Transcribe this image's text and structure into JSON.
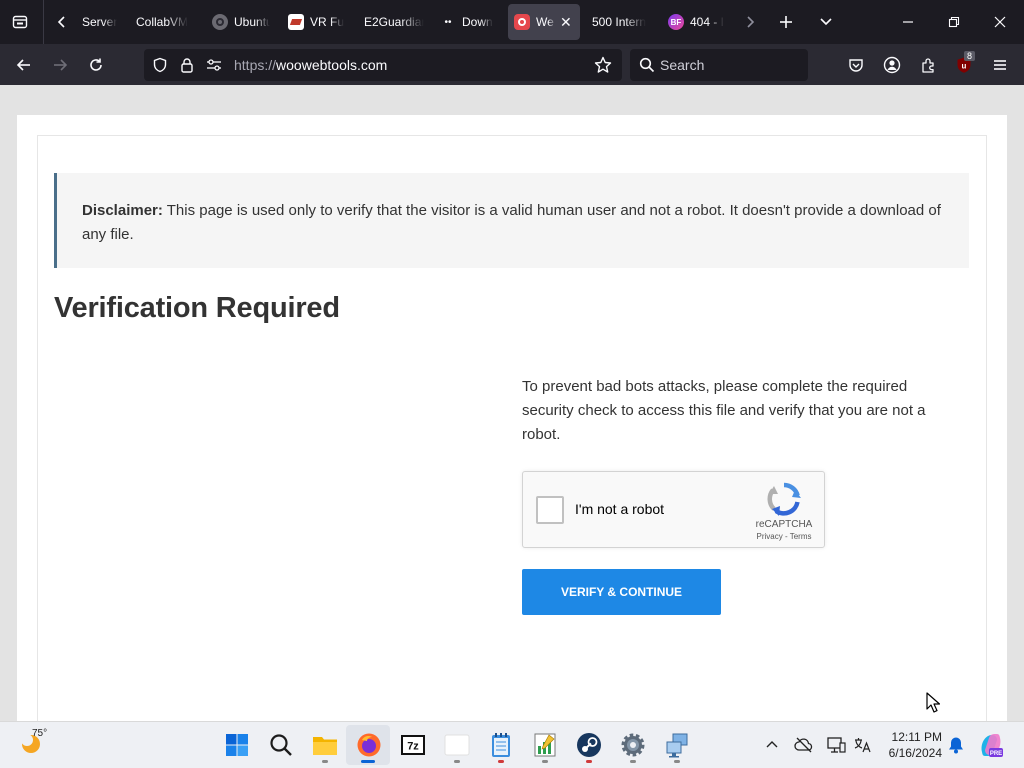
{
  "browser": {
    "tabs": [
      {
        "label": "Server",
        "favicon": "globe-icon"
      },
      {
        "label": "CollabVM",
        "favicon": "none"
      },
      {
        "label": "Ubuntu",
        "favicon": "ubuntu-icon"
      },
      {
        "label": "VR Fu",
        "favicon": "vr-icon"
      },
      {
        "label": "E2Guardian",
        "favicon": "none"
      },
      {
        "label": "Down",
        "favicon": "dots-icon"
      },
      {
        "label": "We",
        "favicon": "shield-icon",
        "active": true
      },
      {
        "label": "500 Intern",
        "favicon": "none"
      },
      {
        "label": "404 - I",
        "favicon": "bf-icon"
      }
    ],
    "url": {
      "scheme": "https://",
      "host": "woowebtools.com"
    },
    "search_placeholder": "Search",
    "extension_badge": "8"
  },
  "page": {
    "disclaimer_label": "Disclaimer:",
    "disclaimer_text": " This page is used only to verify that the visitor is a valid human user and not a robot. It doesn't provide a download of any file.",
    "title": "Verification Required",
    "description": "To prevent bad bots attacks, please complete the required security check to access this file and verify that you are not a robot.",
    "captcha": {
      "checkbox_label": "I'm not a robot",
      "brand": "reCAPTCHA",
      "links": "Privacy - Terms"
    },
    "verify_button": "VERIFY & CONTINUE"
  },
  "taskbar": {
    "temperature": "75°",
    "time": "12:11 PM",
    "date": "6/16/2024"
  },
  "colors": {
    "accent": "#1e88e5",
    "disclaimer_border": "#4a6f8a",
    "tab_bg": "#1c1b22",
    "nav_bg": "#2b2a33"
  }
}
